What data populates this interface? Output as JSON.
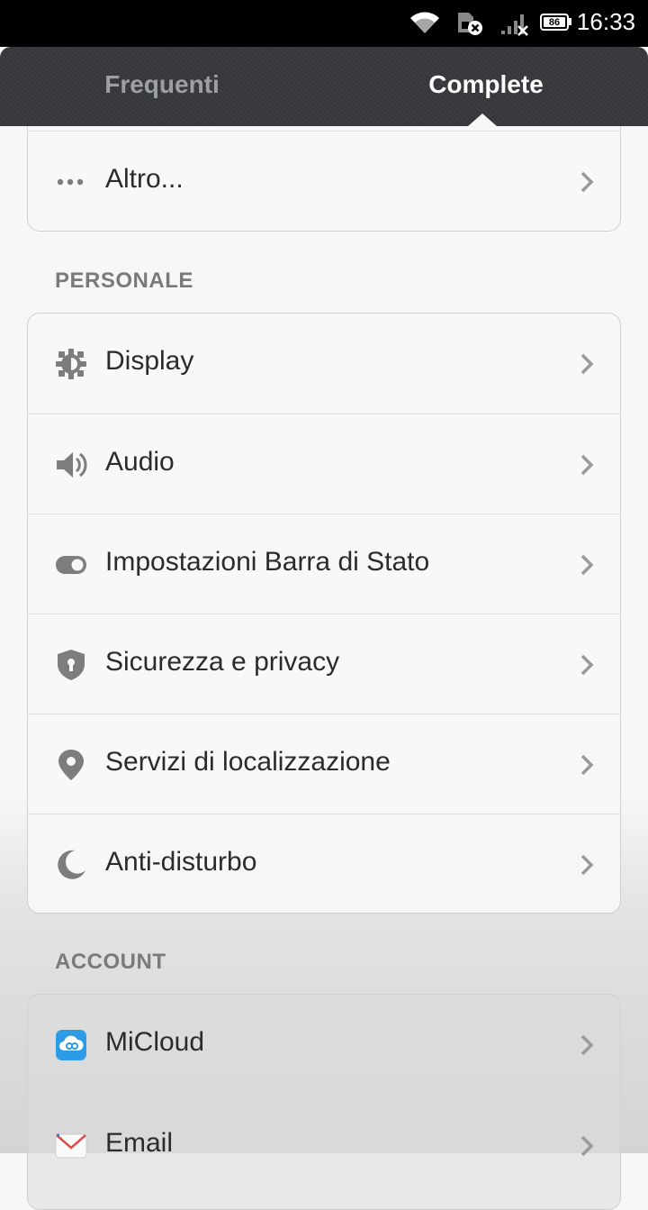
{
  "status_bar": {
    "time": "16:33",
    "battery_level": "86",
    "icons": [
      "wifi-icon",
      "sim-disabled-icon",
      "signal-no-service-icon",
      "battery-icon"
    ]
  },
  "tabs": [
    {
      "label": "Frequenti",
      "selected": false
    },
    {
      "label": "Complete",
      "selected": true
    }
  ],
  "top_card": {
    "items": [
      {
        "label": "Altro...",
        "icon": "more-dots-icon"
      }
    ]
  },
  "sections": [
    {
      "title": "PERSONALE",
      "items": [
        {
          "label": "Display",
          "icon": "brightness-icon"
        },
        {
          "label": "Audio",
          "icon": "speaker-icon"
        },
        {
          "label": "Impostazioni Barra di Stato",
          "icon": "toggle-icon"
        },
        {
          "label": "Sicurezza e privacy",
          "icon": "shield-lock-icon"
        },
        {
          "label": "Servizi di localizzazione",
          "icon": "location-pin-icon"
        },
        {
          "label": "Anti-disturbo",
          "icon": "moon-icon"
        }
      ]
    },
    {
      "title": "ACCOUNT",
      "items": [
        {
          "label": "MiCloud",
          "icon": "micloud-icon"
        },
        {
          "label": "Email",
          "icon": "email-icon"
        }
      ]
    }
  ],
  "colors": {
    "tab_bar": "#3a3c40",
    "icon_gray": "#7d7d7d",
    "micloud_blue": "#2d9be6"
  }
}
